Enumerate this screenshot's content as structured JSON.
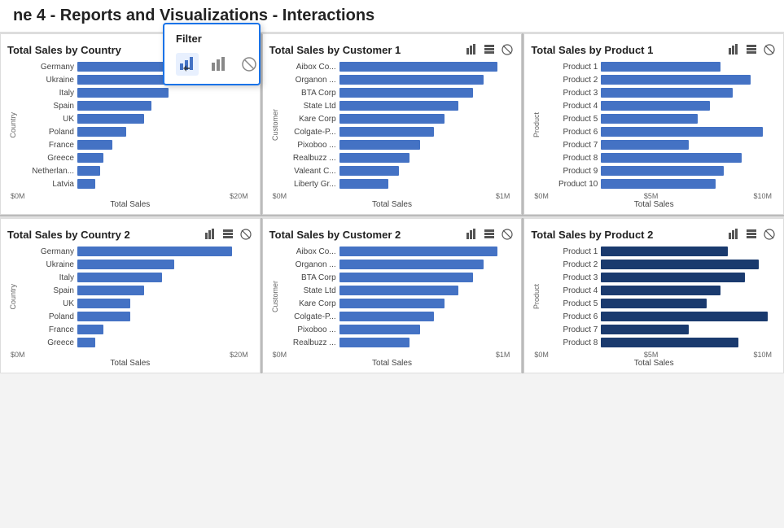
{
  "header": {
    "title": "ne 4 - Reports and Visualizations - Interactions"
  },
  "filter_popup": {
    "title": "Filter",
    "icons": [
      "filter-bars",
      "bar-chart",
      "no-filter"
    ]
  },
  "charts": {
    "row1": [
      {
        "id": "country1",
        "title": "Total Sales by Country",
        "x_axis": "Total Sales",
        "y_axis": "Country",
        "x_labels": [
          "$0M",
          "$20M"
        ],
        "bars": [
          {
            "label": "Germany",
            "pct": 88,
            "color": "blue"
          },
          {
            "label": "Ukraine",
            "pct": 62,
            "color": "blue"
          },
          {
            "label": "Italy",
            "pct": 52,
            "color": "blue"
          },
          {
            "label": "Spain",
            "pct": 42,
            "color": "blue"
          },
          {
            "label": "UK",
            "pct": 38,
            "color": "blue"
          },
          {
            "label": "Poland",
            "pct": 28,
            "color": "blue"
          },
          {
            "label": "France",
            "pct": 20,
            "color": "blue"
          },
          {
            "label": "Greece",
            "pct": 15,
            "color": "blue"
          },
          {
            "label": "Netherlan...",
            "pct": 13,
            "color": "blue"
          },
          {
            "label": "Latvia",
            "pct": 10,
            "color": "blue"
          }
        ]
      },
      {
        "id": "customer1",
        "title": "Total Sales by Customer 1",
        "x_axis": "Total Sales",
        "y_axis": "Customer",
        "x_labels": [
          "$0M",
          "$1M"
        ],
        "bars": [
          {
            "label": "Aibox Co...",
            "pct": 90,
            "color": "blue"
          },
          {
            "label": "Organon ...",
            "pct": 82,
            "color": "blue"
          },
          {
            "label": "BTA Corp",
            "pct": 76,
            "color": "blue"
          },
          {
            "label": "State Ltd",
            "pct": 68,
            "color": "blue"
          },
          {
            "label": "Kare Corp",
            "pct": 60,
            "color": "blue"
          },
          {
            "label": "Colgate-P...",
            "pct": 54,
            "color": "blue"
          },
          {
            "label": "Pixoboo ...",
            "pct": 46,
            "color": "blue"
          },
          {
            "label": "Realbuzz ...",
            "pct": 40,
            "color": "blue"
          },
          {
            "label": "Valeant C...",
            "pct": 34,
            "color": "blue"
          },
          {
            "label": "Liberty Gr...",
            "pct": 28,
            "color": "blue"
          }
        ]
      },
      {
        "id": "product1",
        "title": "Total Sales by Product 1",
        "x_axis": "Total Sales",
        "y_axis": "Product",
        "x_labels": [
          "$0M",
          "$5M",
          "$10M"
        ],
        "bars": [
          {
            "label": "Product 1",
            "pct": 68,
            "color": "blue"
          },
          {
            "label": "Product 2",
            "pct": 85,
            "color": "blue"
          },
          {
            "label": "Product 3",
            "pct": 75,
            "color": "blue"
          },
          {
            "label": "Product 4",
            "pct": 62,
            "color": "blue"
          },
          {
            "label": "Product 5",
            "pct": 55,
            "color": "blue"
          },
          {
            "label": "Product 6",
            "pct": 92,
            "color": "blue"
          },
          {
            "label": "Product 7",
            "pct": 50,
            "color": "blue"
          },
          {
            "label": "Product 8",
            "pct": 80,
            "color": "blue"
          },
          {
            "label": "Product 9",
            "pct": 70,
            "color": "blue"
          },
          {
            "label": "Product 10",
            "pct": 65,
            "color": "blue"
          }
        ]
      }
    ],
    "row2": [
      {
        "id": "country2",
        "title": "Total Sales by Country 2",
        "x_axis": "Total Sales",
        "y_axis": "Country",
        "x_labels": [
          "$0M",
          "$20M"
        ],
        "bars": [
          {
            "label": "Germany",
            "pct": 88,
            "color": "blue"
          },
          {
            "label": "Ukraine",
            "pct": 55,
            "color": "blue"
          },
          {
            "label": "Italy",
            "pct": 48,
            "color": "blue"
          },
          {
            "label": "Spain",
            "pct": 38,
            "color": "blue"
          },
          {
            "label": "UK",
            "pct": 30,
            "color": "blue"
          },
          {
            "label": "Poland",
            "pct": 30,
            "color": "blue"
          },
          {
            "label": "France",
            "pct": 15,
            "color": "blue"
          },
          {
            "label": "Greece",
            "pct": 10,
            "color": "blue"
          }
        ]
      },
      {
        "id": "customer2",
        "title": "Total Sales by Customer 2",
        "x_axis": "Total Sales",
        "y_axis": "Customer",
        "x_labels": [
          "$0M",
          "$1M"
        ],
        "bars": [
          {
            "label": "Aibox Co...",
            "pct": 90,
            "color": "blue"
          },
          {
            "label": "Organon ...",
            "pct": 82,
            "color": "blue"
          },
          {
            "label": "BTA Corp",
            "pct": 76,
            "color": "blue"
          },
          {
            "label": "State Ltd",
            "pct": 68,
            "color": "blue"
          },
          {
            "label": "Kare Corp",
            "pct": 60,
            "color": "blue"
          },
          {
            "label": "Colgate-P...",
            "pct": 54,
            "color": "blue"
          },
          {
            "label": "Pixoboo ...",
            "pct": 46,
            "color": "blue"
          },
          {
            "label": "Realbuzz ...",
            "pct": 40,
            "color": "blue"
          }
        ]
      },
      {
        "id": "product2",
        "title": "Total Sales by Product 2",
        "x_axis": "Total Sales",
        "y_axis": "Product",
        "x_labels": [
          "$0M",
          "$5M",
          "$10M"
        ],
        "bars": [
          {
            "label": "Product 1",
            "pct": 72,
            "color": "dark-blue"
          },
          {
            "label": "Product 2",
            "pct": 90,
            "color": "dark-blue"
          },
          {
            "label": "Product 3",
            "pct": 82,
            "color": "dark-blue"
          },
          {
            "label": "Product 4",
            "pct": 68,
            "color": "dark-blue"
          },
          {
            "label": "Product 5",
            "pct": 60,
            "color": "dark-blue"
          },
          {
            "label": "Product 6",
            "pct": 95,
            "color": "dark-blue"
          },
          {
            "label": "Product 7",
            "pct": 50,
            "color": "dark-blue"
          },
          {
            "label": "Product 8",
            "pct": 78,
            "color": "dark-blue"
          }
        ]
      }
    ]
  }
}
